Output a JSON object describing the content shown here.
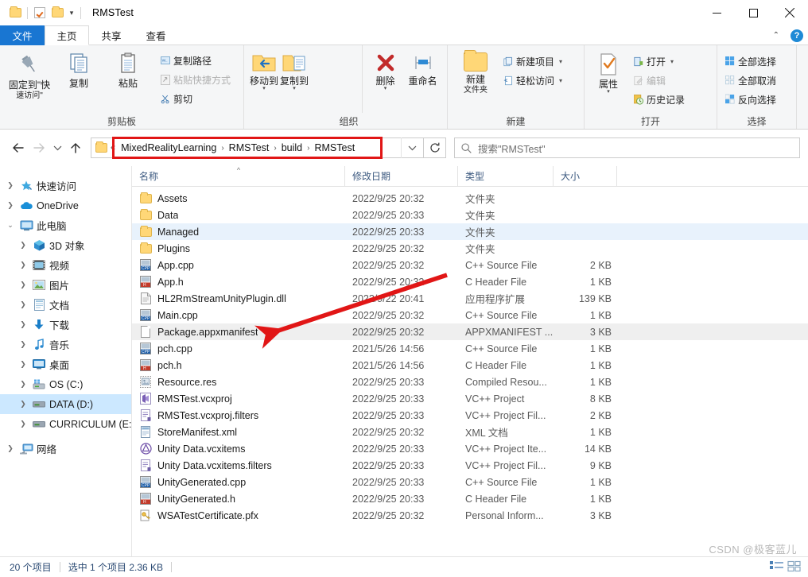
{
  "window": {
    "title": "RMSTest",
    "minimize_label": "最小化",
    "maximize_label": "最大化",
    "close_label": "关闭"
  },
  "quick_access_toolbar": {
    "items": [
      {
        "name": "folder-icon",
        "label": "属性"
      },
      {
        "name": "checkbox-icon",
        "label": "新建文件夹"
      },
      {
        "name": "folder-icon-2",
        "label": "自定义"
      }
    ],
    "customize_label": "自定义快速访问工具栏"
  },
  "tabs": [
    {
      "id": "file",
      "label": "文件"
    },
    {
      "id": "home",
      "label": "主页"
    },
    {
      "id": "share",
      "label": "共享"
    },
    {
      "id": "view",
      "label": "查看"
    }
  ],
  "active_tab": "home",
  "ribbon_right": {
    "collapse_label": "^",
    "help_label": "?"
  },
  "ribbon": {
    "groups": [
      {
        "id": "clipboard",
        "label": "剪贴板",
        "big_buttons": [
          {
            "name": "pin-to-quick-access",
            "line1": "固定到\"快",
            "line2": "速访问\""
          },
          {
            "name": "copy",
            "line1": "复制",
            "line2": ""
          },
          {
            "name": "paste",
            "line1": "粘贴",
            "line2": ""
          }
        ],
        "small_buttons": [
          {
            "name": "copy-path",
            "label": "复制路径",
            "disabled": false
          },
          {
            "name": "paste-shortcut",
            "label": "粘贴快捷方式",
            "disabled": true
          }
        ],
        "cut_label": "剪切"
      },
      {
        "id": "organize",
        "label": "组织",
        "big_buttons": [
          {
            "name": "move-to",
            "line1": "移动到",
            "line2": ""
          },
          {
            "name": "copy-to",
            "line1": "复制到",
            "line2": ""
          },
          {
            "name": "delete",
            "line1": "删除",
            "line2": ""
          },
          {
            "name": "rename",
            "line1": "重命名",
            "line2": ""
          }
        ]
      },
      {
        "id": "new",
        "label": "新建",
        "big_buttons": [
          {
            "name": "new-folder",
            "line1": "新建",
            "line2": "文件夹"
          }
        ],
        "small_buttons": [
          {
            "name": "new-item",
            "label": "新建项目",
            "has_dropdown": true
          },
          {
            "name": "easy-access",
            "label": "轻松访问",
            "has_dropdown": true
          }
        ]
      },
      {
        "id": "open",
        "label": "打开",
        "big_buttons": [
          {
            "name": "properties",
            "line1": "属性",
            "line2": ""
          }
        ],
        "small_buttons": [
          {
            "name": "open",
            "label": "打开",
            "has_dropdown": true,
            "disabled": false
          },
          {
            "name": "edit",
            "label": "编辑",
            "disabled": true
          },
          {
            "name": "history",
            "label": "历史记录",
            "disabled": false
          }
        ]
      },
      {
        "id": "select",
        "label": "选择",
        "small_buttons": [
          {
            "name": "select-all",
            "label": "全部选择"
          },
          {
            "name": "select-none",
            "label": "全部取消"
          },
          {
            "name": "invert-selection",
            "label": "反向选择"
          }
        ]
      }
    ]
  },
  "navigation": {
    "back_label": "后退",
    "forward_label": "前进",
    "recent_label": "最近浏览的位置",
    "up_label": "上移到",
    "overflow_label": "«",
    "breadcrumbs": [
      "MixedRealityLearning",
      "RMSTest",
      "build",
      "RMSTest"
    ],
    "separator": "›",
    "dropdown_label": "v",
    "refresh_label": "刷新"
  },
  "search": {
    "placeholder": "搜索\"RMSTest\"",
    "icon": "search-icon"
  },
  "sidebar": {
    "items": [
      {
        "label": "快速访问",
        "icon": "star-pin-icon",
        "level": 0,
        "expander": "collapsed",
        "selected": false
      },
      {
        "label": "OneDrive",
        "icon": "onedrive-cloud-icon",
        "level": 0,
        "expander": "collapsed",
        "selected": false
      },
      {
        "label": "此电脑",
        "icon": "this-pc-icon",
        "level": 0,
        "expander": "expanded",
        "selected": false
      },
      {
        "label": "3D 对象",
        "icon": "3d-objects-icon",
        "level": 1,
        "expander": "collapsed",
        "selected": false
      },
      {
        "label": "视频",
        "icon": "videos-icon",
        "level": 1,
        "expander": "collapsed",
        "selected": false
      },
      {
        "label": "图片",
        "icon": "pictures-icon",
        "level": 1,
        "expander": "collapsed",
        "selected": false
      },
      {
        "label": "文档",
        "icon": "documents-icon",
        "level": 1,
        "expander": "collapsed",
        "selected": false
      },
      {
        "label": "下载",
        "icon": "downloads-icon",
        "level": 1,
        "expander": "collapsed",
        "selected": false
      },
      {
        "label": "音乐",
        "icon": "music-icon",
        "level": 1,
        "expander": "collapsed",
        "selected": false
      },
      {
        "label": "桌面",
        "icon": "desktop-icon",
        "level": 1,
        "expander": "collapsed",
        "selected": false
      },
      {
        "label": "OS (C:)",
        "icon": "os-drive-icon",
        "level": 1,
        "expander": "collapsed",
        "selected": false
      },
      {
        "label": "DATA (D:)",
        "icon": "drive-icon",
        "level": 1,
        "expander": "collapsed",
        "selected": true
      },
      {
        "label": "CURRICULUM (E:)",
        "icon": "drive-icon",
        "level": 1,
        "expander": "collapsed",
        "selected": false
      },
      {
        "label": "网络",
        "icon": "network-icon",
        "level": 0,
        "expander": "collapsed",
        "selected": false
      }
    ]
  },
  "file_list": {
    "columns": [
      {
        "id": "name",
        "label": "名称",
        "sorted": true
      },
      {
        "id": "date",
        "label": "修改日期"
      },
      {
        "id": "type",
        "label": "类型"
      },
      {
        "id": "size",
        "label": "大小"
      }
    ],
    "sort_indicator": "^",
    "rows": [
      {
        "name": "Assets",
        "date": "2022/9/25 20:32",
        "type": "文件夹",
        "size": "",
        "icon": "folder-icon",
        "state": "none"
      },
      {
        "name": "Data",
        "date": "2022/9/25 20:33",
        "type": "文件夹",
        "size": "",
        "icon": "folder-icon",
        "state": "none"
      },
      {
        "name": "Managed",
        "date": "2022/9/25 20:33",
        "type": "文件夹",
        "size": "",
        "icon": "folder-icon",
        "state": "hover"
      },
      {
        "name": "Plugins",
        "date": "2022/9/25 20:32",
        "type": "文件夹",
        "size": "",
        "icon": "folder-icon",
        "state": "none"
      },
      {
        "name": "App.cpp",
        "date": "2022/9/25 20:32",
        "type": "C++ Source File",
        "size": "2 KB",
        "icon": "cpp-file-icon",
        "state": "none"
      },
      {
        "name": "App.h",
        "date": "2022/9/25 20:32",
        "type": "C Header File",
        "size": "1 KB",
        "icon": "h-file-icon",
        "state": "none"
      },
      {
        "name": "HL2RmStreamUnityPlugin.dll",
        "date": "2022/9/22 20:41",
        "type": "应用程序扩展",
        "size": "139 KB",
        "icon": "dll-file-icon",
        "state": "none"
      },
      {
        "name": "Main.cpp",
        "date": "2022/9/25 20:32",
        "type": "C++ Source File",
        "size": "1 KB",
        "icon": "cpp-file-icon",
        "state": "none"
      },
      {
        "name": "Package.appxmanifest",
        "date": "2022/9/25 20:32",
        "type": "APPXMANIFEST ...",
        "size": "3 KB",
        "icon": "generic-file-icon",
        "state": "selected"
      },
      {
        "name": "pch.cpp",
        "date": "2021/5/26 14:56",
        "type": "C++ Source File",
        "size": "1 KB",
        "icon": "cpp-file-icon",
        "state": "none"
      },
      {
        "name": "pch.h",
        "date": "2021/5/26 14:56",
        "type": "C Header File",
        "size": "1 KB",
        "icon": "h-file-icon",
        "state": "none"
      },
      {
        "name": "Resource.res",
        "date": "2022/9/25 20:33",
        "type": "Compiled Resou...",
        "size": "1 KB",
        "icon": "res-file-icon",
        "state": "none"
      },
      {
        "name": "RMSTest.vcxproj",
        "date": "2022/9/25 20:33",
        "type": "VC++ Project",
        "size": "8 KB",
        "icon": "vcxproj-file-icon",
        "state": "none"
      },
      {
        "name": "RMSTest.vcxproj.filters",
        "date": "2022/9/25 20:33",
        "type": "VC++ Project Fil...",
        "size": "2 KB",
        "icon": "filters-file-icon",
        "state": "none"
      },
      {
        "name": "StoreManifest.xml",
        "date": "2022/9/25 20:32",
        "type": "XML 文档",
        "size": "1 KB",
        "icon": "xml-file-icon",
        "state": "none"
      },
      {
        "name": "Unity Data.vcxitems",
        "date": "2022/9/25 20:33",
        "type": "VC++ Project Ite...",
        "size": "14 KB",
        "icon": "vcxitems-file-icon",
        "state": "none"
      },
      {
        "name": "Unity Data.vcxitems.filters",
        "date": "2022/9/25 20:33",
        "type": "VC++ Project Fil...",
        "size": "9 KB",
        "icon": "filters-file-icon",
        "state": "none"
      },
      {
        "name": "UnityGenerated.cpp",
        "date": "2022/9/25 20:33",
        "type": "C++ Source File",
        "size": "1 KB",
        "icon": "cpp-file-icon",
        "state": "none"
      },
      {
        "name": "UnityGenerated.h",
        "date": "2022/9/25 20:33",
        "type": "C Header File",
        "size": "1 KB",
        "icon": "h-file-icon",
        "state": "none"
      },
      {
        "name": "WSATestCertificate.pfx",
        "date": "2022/9/25 20:32",
        "type": "Personal Inform...",
        "size": "3 KB",
        "icon": "pfx-file-icon",
        "state": "none"
      }
    ]
  },
  "status_bar": {
    "item_count": "20 个项目",
    "selection": "选中 1 个项目  2.36 KB",
    "view_details_label": "详细信息视图",
    "view_large_label": "大图标视图"
  },
  "watermark": "CSDN @极客蓝儿",
  "annotation": {
    "highlight_box_label": "address-path-highlight",
    "arrow_label": "points-to-package-appxmanifest",
    "color": "#e11616"
  },
  "colors": {
    "accent": "#1976d2",
    "selection": "#cce8ff",
    "folder": "#ffd777",
    "annotation_red": "#e11616",
    "header_text": "#3d5a80"
  }
}
